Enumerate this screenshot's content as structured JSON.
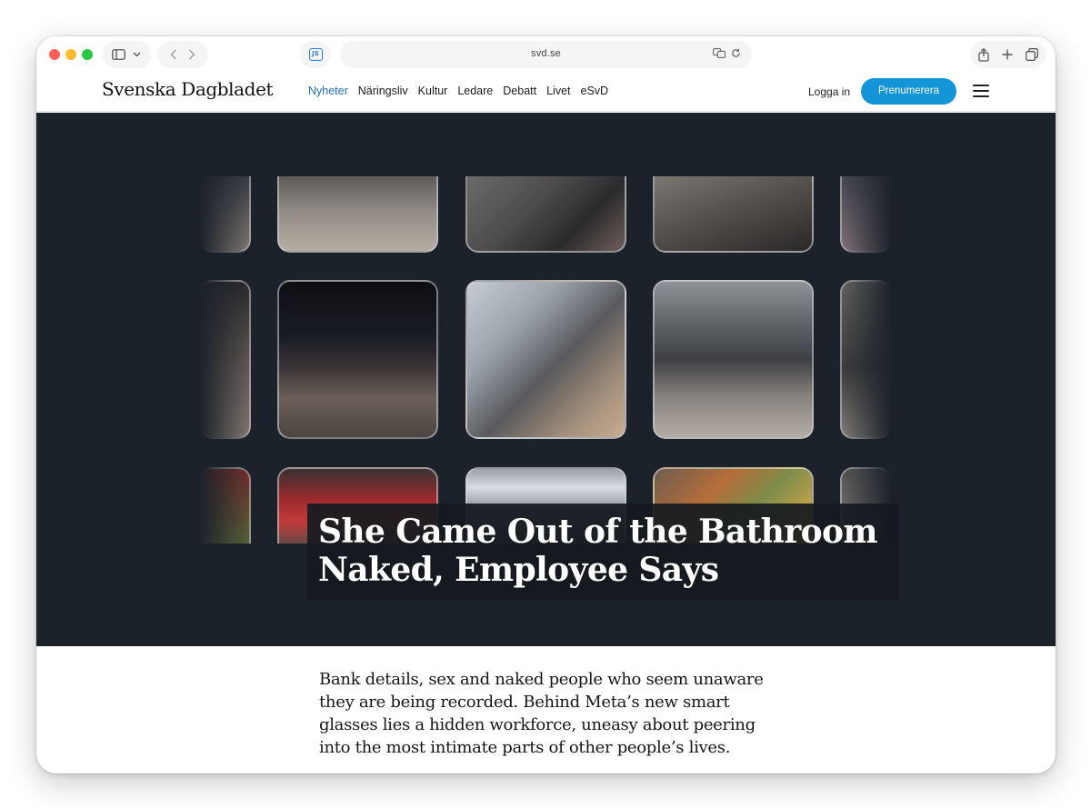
{
  "browser": {
    "url": "svd.se",
    "js_badge": "JS"
  },
  "site": {
    "brand": "Svenska Dagbladet",
    "nav": [
      {
        "label": "Nyheter",
        "active": true
      },
      {
        "label": "Näringsliv",
        "active": false
      },
      {
        "label": "Kultur",
        "active": false
      },
      {
        "label": "Ledare",
        "active": false
      },
      {
        "label": "Debatt",
        "active": false
      },
      {
        "label": "Livet",
        "active": false
      },
      {
        "label": "eSvD",
        "active": false
      }
    ],
    "login": "Logga in",
    "subscribe": "Prenumerera"
  },
  "article": {
    "headline": "She Came Out of the Bathroom Naked, Employee Says",
    "lead": "Bank details, sex and naked people who seem unaware they are being recorded. Behind Meta’s new smart glasses lies a hidden workforce, uneasy about peering into the most intimate parts of other people’s lives."
  },
  "colors": {
    "accent": "#1495d8",
    "nav_active": "#1f6fb0",
    "hero_bg": "#1c222a"
  }
}
